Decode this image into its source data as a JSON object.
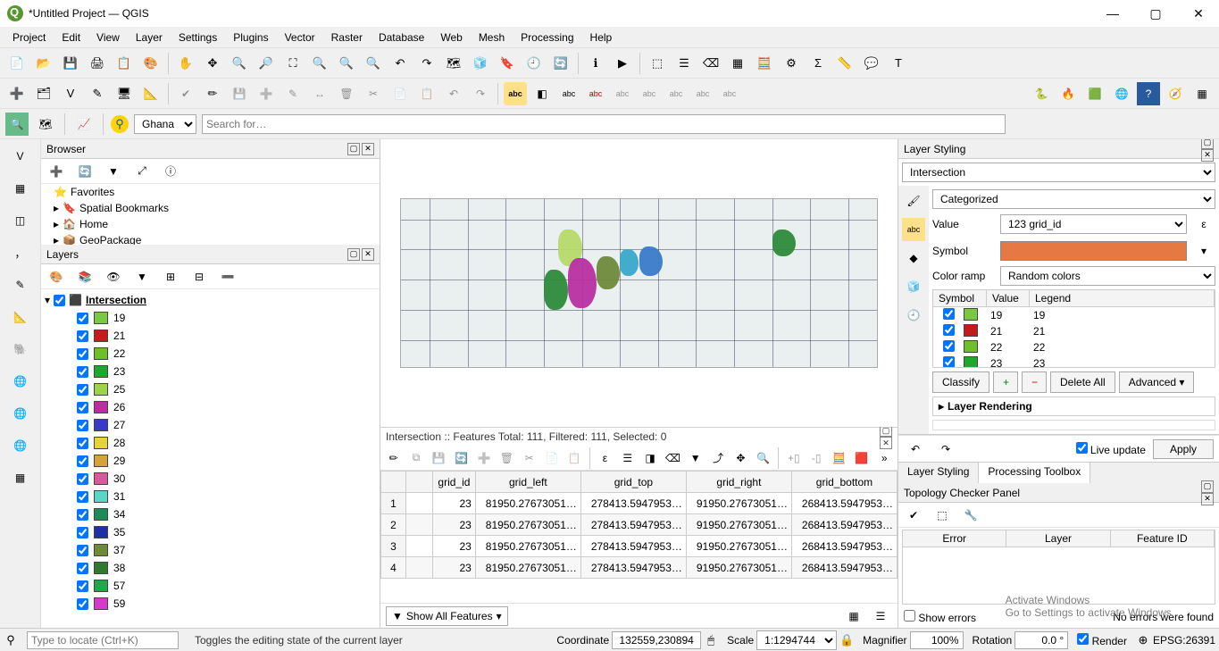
{
  "window": {
    "title": "*Untitled Project — QGIS"
  },
  "menus": [
    "Project",
    "Edit",
    "View",
    "Layer",
    "Settings",
    "Plugins",
    "Vector",
    "Raster",
    "Database",
    "Web",
    "Mesh",
    "Processing",
    "Help"
  ],
  "locator": {
    "placeholder": "Type to locate (Ctrl+K)"
  },
  "search_combo": {
    "value": "Ghana"
  },
  "search_input": {
    "placeholder": "Search for…"
  },
  "browser": {
    "title": "Browser",
    "items": [
      "Favorites",
      "Spatial Bookmarks",
      "Home",
      "GeoPackage"
    ]
  },
  "layers": {
    "title": "Layers",
    "root": "Intersection",
    "legend": [
      {
        "value": "19",
        "color": "#7ac943"
      },
      {
        "value": "21",
        "color": "#c41c1c"
      },
      {
        "value": "22",
        "color": "#6fbf2a"
      },
      {
        "value": "23",
        "color": "#1fa82e"
      },
      {
        "value": "25",
        "color": "#9fd24b"
      },
      {
        "value": "26",
        "color": "#b82fa0"
      },
      {
        "value": "27",
        "color": "#3a3ac9"
      },
      {
        "value": "28",
        "color": "#e6d23a"
      },
      {
        "value": "29",
        "color": "#d6a23a"
      },
      {
        "value": "30",
        "color": "#d65a9a"
      },
      {
        "value": "31",
        "color": "#5ad6c9"
      },
      {
        "value": "34",
        "color": "#1f8a5a"
      },
      {
        "value": "35",
        "color": "#1f2fa8"
      },
      {
        "value": "37",
        "color": "#6f8a3a"
      },
      {
        "value": "38",
        "color": "#2f7a2f"
      },
      {
        "value": "57",
        "color": "#1fa84a"
      },
      {
        "value": "59",
        "color": "#d63ac9"
      }
    ]
  },
  "attribute_table": {
    "title": "Intersection :: Features Total: 111, Filtered: 111, Selected: 0",
    "columns": [
      "grid_id",
      "grid_left",
      "grid_top",
      "grid_right",
      "grid_bottom"
    ],
    "rows": [
      {
        "n": "1",
        "grid_id": "23",
        "grid_left": "81950.27673051…",
        "grid_top": "278413.5947953…",
        "grid_right": "91950.27673051…",
        "grid_bottom": "268413.5947953…"
      },
      {
        "n": "2",
        "grid_id": "23",
        "grid_left": "81950.27673051…",
        "grid_top": "278413.5947953…",
        "grid_right": "91950.27673051…",
        "grid_bottom": "268413.5947953…"
      },
      {
        "n": "3",
        "grid_id": "23",
        "grid_left": "81950.27673051…",
        "grid_top": "278413.5947953…",
        "grid_right": "91950.27673051…",
        "grid_bottom": "268413.5947953…"
      },
      {
        "n": "4",
        "grid_id": "23",
        "grid_left": "81950.27673051…",
        "grid_top": "278413.5947953…",
        "grid_right": "91950.27673051…",
        "grid_bottom": "268413.5947953…"
      }
    ],
    "show_all": "Show All Features"
  },
  "layer_styling": {
    "title": "Layer Styling",
    "layer": "Intersection",
    "renderer": "Categorized",
    "value_label": "Value",
    "value_field": "grid_id",
    "value_prefix": "123",
    "symbol_label": "Symbol",
    "color_ramp_label": "Color ramp",
    "color_ramp": "Random colors",
    "class_head": {
      "symbol": "Symbol",
      "value": "Value",
      "legend": "Legend"
    },
    "classes": [
      {
        "color": "#7ac943",
        "value": "19",
        "legend": "19"
      },
      {
        "color": "#c41c1c",
        "value": "21",
        "legend": "21"
      },
      {
        "color": "#6fbf2a",
        "value": "22",
        "legend": "22"
      },
      {
        "color": "#1fa82e",
        "value": "23",
        "legend": "23"
      }
    ],
    "buttons": {
      "classify": "Classify",
      "delete_all": "Delete All",
      "advanced": "Advanced"
    },
    "rendering": "Layer Rendering",
    "live_update": "Live update",
    "apply": "Apply"
  },
  "bottom_tabs": {
    "styling": "Layer Styling",
    "processing": "Processing Toolbox"
  },
  "topology": {
    "title": "Topology Checker Panel",
    "cols": {
      "error": "Error",
      "layer": "Layer",
      "feature": "Feature ID"
    },
    "show_errors": "Show errors",
    "no_errors": "No errors were found"
  },
  "status": {
    "hint": "Toggles the editing state of the current layer",
    "coord_label": "Coordinate",
    "coord": "132559,230894",
    "scale_label": "Scale",
    "scale": "1:1294744",
    "mag_label": "Magnifier",
    "mag": "100%",
    "rot_label": "Rotation",
    "rot": "0.0 °",
    "render": "Render",
    "crs": "EPSG:26391"
  },
  "watermark": {
    "line1": "Activate Windows",
    "line2": "Go to Settings to activate Windows."
  }
}
